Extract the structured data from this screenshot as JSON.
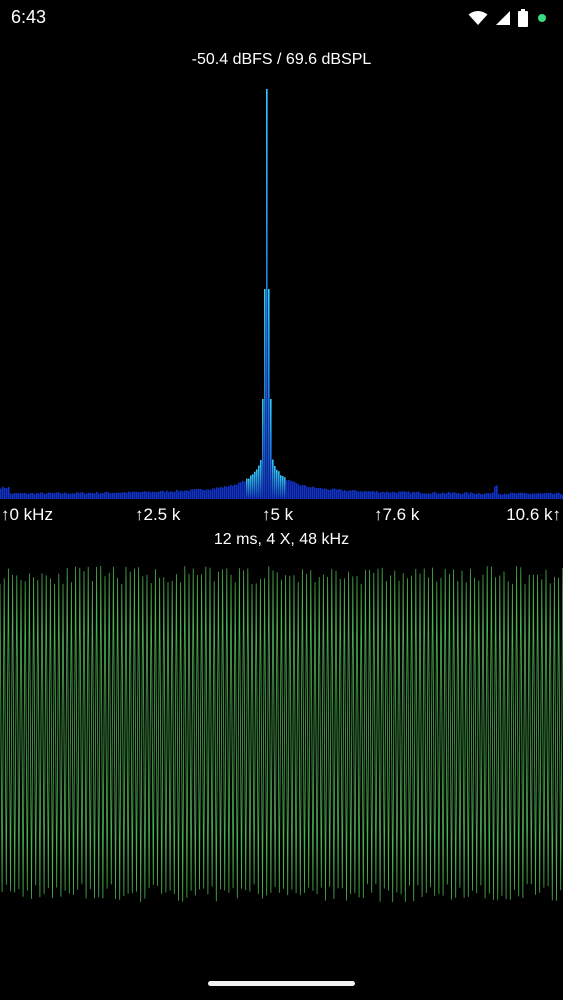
{
  "status_bar": {
    "time": "6:43",
    "icons": [
      "wifi-icon",
      "cell-signal-icon",
      "battery-icon",
      "privacy-indicator-dot"
    ],
    "indicator_color": "#3ddc84"
  },
  "spectrum": {
    "level_readout": "-50.4 dBFS / 69.6 dBSPL",
    "freq_labels": [
      "↑0 kHz",
      "↑2.5 k",
      "↑5 k",
      "↑7.6 k",
      "10.6 k↑"
    ],
    "peak_freq_khz": 5.0,
    "secondary_peak_freq_khz": 9.3,
    "bar_color_low": "#1133cc",
    "bar_color_high": "#33ccff"
  },
  "waveform": {
    "info": "12 ms, 4 X, 48 kHz",
    "color": "#4caf50"
  },
  "colors": {
    "background": "#000000",
    "text": "#ffffff",
    "home_indicator": "#f2f2f2"
  }
}
